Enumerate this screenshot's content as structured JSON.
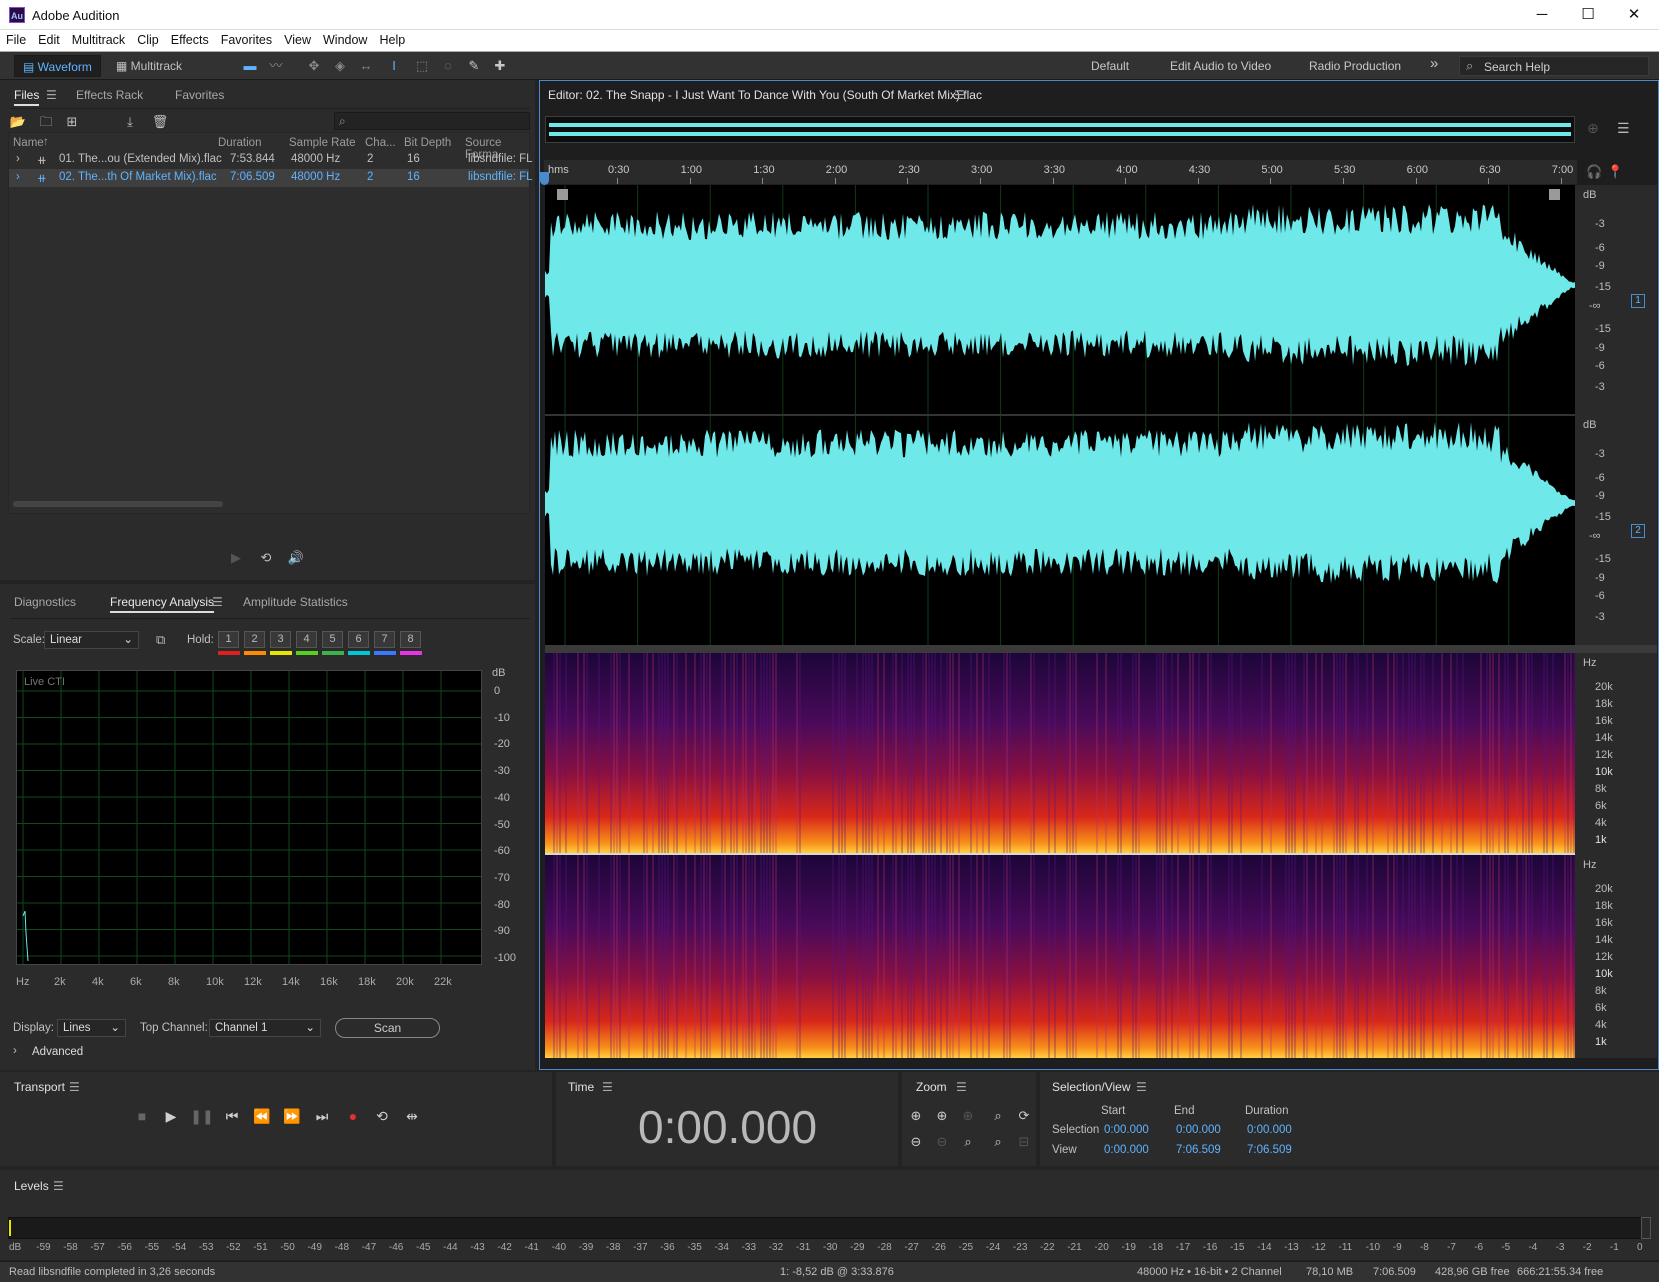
{
  "window": {
    "title": "Adobe Audition",
    "app_icon_text": "Au"
  },
  "menu": [
    "File",
    "Edit",
    "Multitrack",
    "Clip",
    "Effects",
    "Favorites",
    "View",
    "Window",
    "Help"
  ],
  "toolbar": {
    "waveform_label": "Waveform",
    "multitrack_label": "Multitrack",
    "workspaces": [
      "Default",
      "Edit Audio to Video",
      "Radio Production"
    ],
    "more": "»",
    "search_placeholder": "Search Help"
  },
  "files_panel": {
    "tabs": [
      "Files",
      "Effects Rack",
      "Favorites"
    ],
    "columns": [
      "Name",
      "Duration",
      "Sample Rate",
      "Cha...",
      "Bit Depth",
      "Source Forma"
    ],
    "rows": [
      {
        "name": "01. The...ou (Extended Mix).flac",
        "duration": "7:53.844",
        "rate": "48000 Hz",
        "ch": "2",
        "bits": "16",
        "fmt": "libsndfile: FL",
        "selected": false
      },
      {
        "name": "02. The...th Of Market Mix).flac",
        "duration": "7:06.509",
        "rate": "48000 Hz",
        "ch": "2",
        "bits": "16",
        "fmt": "libsndfile: FL",
        "selected": true
      }
    ]
  },
  "analysis_panel": {
    "tabs": [
      "Diagnostics",
      "Frequency Analysis",
      "Amplitude Statistics"
    ],
    "scale_label": "Scale:",
    "scale_value": "Linear",
    "hold_label": "Hold:",
    "hold_buttons": [
      "1",
      "2",
      "3",
      "4",
      "5",
      "6",
      "7",
      "8"
    ],
    "hold_colors": [
      "#e02020",
      "#ff8c00",
      "#e6e600",
      "#56d11c",
      "#3cb44b",
      "#00c8d2",
      "#3c78ff",
      "#e633e6"
    ],
    "graph_label": "Live CTI",
    "db_unit": "dB",
    "db_ticks": [
      "0",
      "-10",
      "-20",
      "-30",
      "-40",
      "-50",
      "-60",
      "-70",
      "-80",
      "-90",
      "-100"
    ],
    "hz_ticks": [
      "Hz",
      "2k",
      "4k",
      "6k",
      "8k",
      "10k",
      "12k",
      "14k",
      "16k",
      "18k",
      "20k",
      "22k"
    ],
    "display_label": "Display:",
    "display_value": "Lines",
    "top_channel_label": "Top Channel:",
    "top_channel_value": "Channel 1",
    "scan_button": "Scan",
    "advanced_label": "Advanced"
  },
  "editor": {
    "title": "Editor: 02. The Snapp - I Just Want To Dance With You (South Of Market Mix).flac",
    "ruler_unit": "hms",
    "ruler_ticks": [
      "0:30",
      "1:00",
      "1:30",
      "2:00",
      "2:30",
      "3:00",
      "3:30",
      "4:00",
      "4:30",
      "5:00",
      "5:30",
      "6:00",
      "6:30",
      "7:00"
    ],
    "db_unit": "dB",
    "db_scale": [
      "-3",
      "-6",
      "-9",
      "-15",
      "-∞",
      "-15",
      "-9",
      "-6",
      "-3"
    ],
    "channel_badges": [
      "1",
      "2"
    ],
    "hz_unit": "Hz",
    "hz_scale": [
      "20k",
      "18k",
      "16k",
      "14k",
      "12k",
      "10k",
      "8k",
      "6k",
      "4k",
      "1k"
    ],
    "waveform_color": "#6ee8e8",
    "accent_color": "#4a8bd0"
  },
  "transport": {
    "title": "Transport"
  },
  "time_panel": {
    "title": "Time",
    "value": "0:00.000"
  },
  "zoom_panel": {
    "title": "Zoom"
  },
  "selection_panel": {
    "title": "Selection/View",
    "headers": [
      "Start",
      "End",
      "Duration"
    ],
    "rows": [
      {
        "label": "Selection",
        "start": "0:00.000",
        "end": "0:00.000",
        "duration": "0:00.000"
      },
      {
        "label": "View",
        "start": "0:00.000",
        "end": "7:06.509",
        "duration": "7:06.509"
      }
    ]
  },
  "levels_panel": {
    "title": "Levels",
    "ticks": [
      "dB",
      "-59",
      "-58",
      "-57",
      "-56",
      "-55",
      "-54",
      "-53",
      "-52",
      "-51",
      "-50",
      "-49",
      "-48",
      "-47",
      "-46",
      "-45",
      "-44",
      "-43",
      "-42",
      "-41",
      "-40",
      "-39",
      "-38",
      "-37",
      "-36",
      "-35",
      "-34",
      "-33",
      "-32",
      "-31",
      "-30",
      "-29",
      "-28",
      "-27",
      "-26",
      "-25",
      "-24",
      "-23",
      "-22",
      "-21",
      "-20",
      "-19",
      "-18",
      "-17",
      "-16",
      "-15",
      "-14",
      "-13",
      "-12",
      "-11",
      "-10",
      "-9",
      "-8",
      "-7",
      "-6",
      "-5",
      "-4",
      "-3",
      "-2",
      "-1",
      "0"
    ]
  },
  "status": {
    "message": "Read libsndfile completed in 3,26 seconds",
    "cursor": "1: -8,52 dB @ 3:33.876",
    "format": "48000 Hz • 16-bit • 2 Channel",
    "size": "78,10 MB",
    "duration": "7:06.509",
    "free": "428,96 GB free",
    "free_time": "666:21:55.34 free"
  }
}
